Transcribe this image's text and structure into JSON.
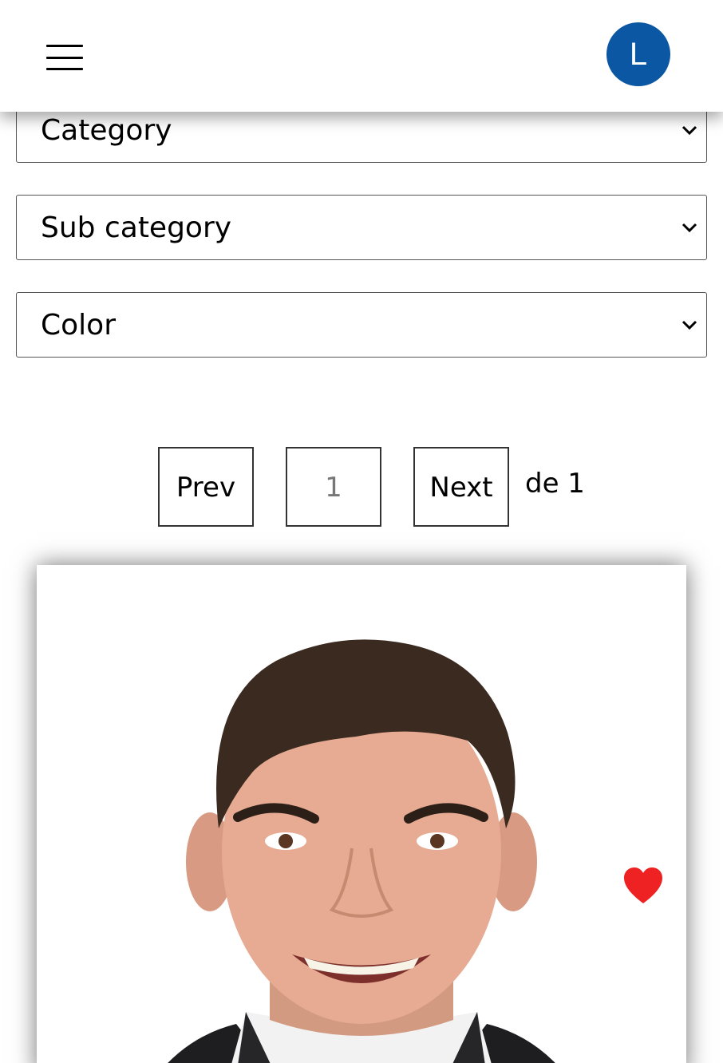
{
  "header": {
    "menu_icon": "hamburger-menu-icon",
    "avatar_letter": "L",
    "avatar_color": "#0b57a4"
  },
  "filters": {
    "category": "Category",
    "sub_category": "Sub category",
    "color": "Color"
  },
  "pagination": {
    "prev_label": "Prev",
    "current_page": "1",
    "next_label": "Next",
    "of_total": "de 1"
  },
  "product_card": {
    "image": "portrait-photo",
    "favorite_icon": "heart-icon",
    "favorite_color": "#ee2222"
  }
}
